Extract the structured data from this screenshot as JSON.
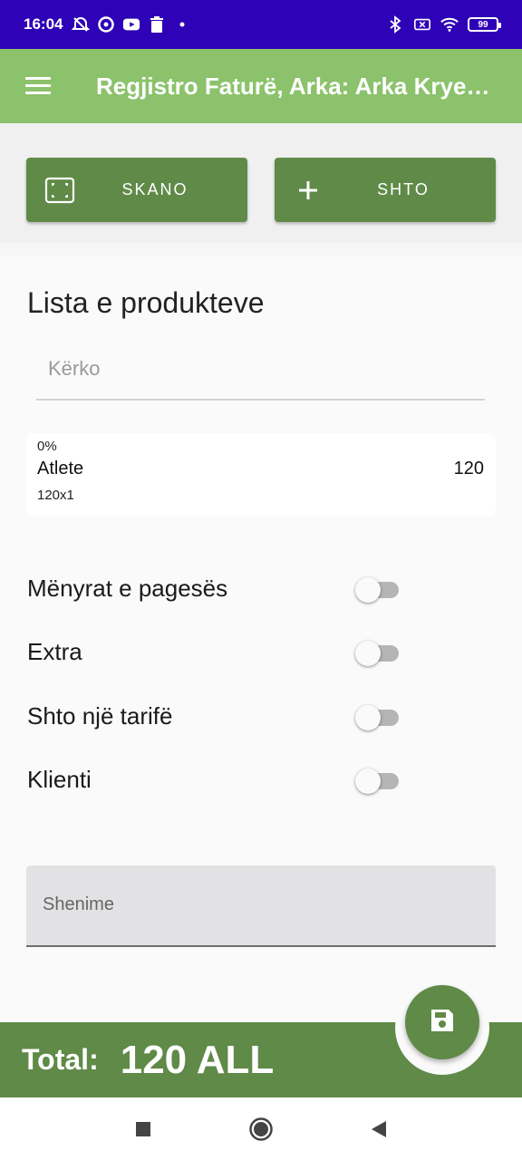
{
  "status_bar": {
    "time": "16:04",
    "battery": "99",
    "icons_left": [
      "alarm-off-icon",
      "data-saver-icon",
      "youtube-icon",
      "trash-icon",
      "dot-icon"
    ],
    "icons_right": [
      "bluetooth-icon",
      "sim-off-icon",
      "wifi-icon",
      "battery-icon"
    ]
  },
  "app_bar": {
    "title": "Regjistro Faturë, Arka: Arka Kryesore"
  },
  "actions": {
    "scan_label": "SKANO",
    "add_label": "SHTO"
  },
  "products": {
    "section_title": "Lista e produkteve",
    "search_placeholder": "Kërko",
    "items": [
      {
        "discount": "0%",
        "name": "Atlete",
        "qty": "120x1",
        "price": "120"
      }
    ]
  },
  "toggles": [
    {
      "label": "Mënyrat e pagesës",
      "on": false
    },
    {
      "label": "Extra",
      "on": false
    },
    {
      "label": "Shto një tarifë",
      "on": false
    },
    {
      "label": "Klienti",
      "on": false
    }
  ],
  "notes": {
    "placeholder": "Shenime"
  },
  "total": {
    "label": "Total:",
    "value": "120 ALL"
  },
  "colors": {
    "status_bar": "#2e02b6",
    "app_bar": "#8bc26b",
    "primary_dark": "#5f8a47"
  }
}
